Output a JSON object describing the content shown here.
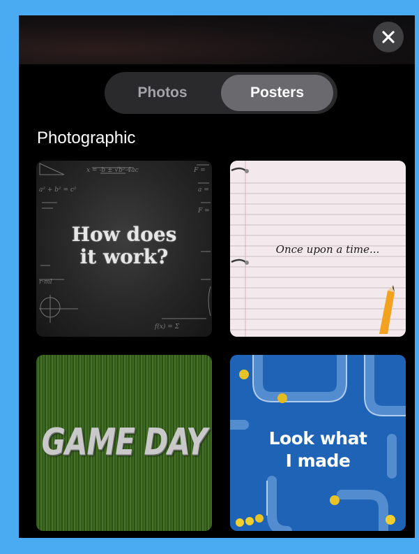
{
  "header": {
    "close_icon": "close-icon"
  },
  "segmented_control": {
    "options": [
      {
        "label": "Photos",
        "selected": false
      },
      {
        "label": "Posters",
        "selected": true
      }
    ]
  },
  "section": {
    "title": "Photographic",
    "tiles": [
      {
        "text": "How does\nit work?",
        "style": "chalkboard"
      },
      {
        "text": "Once upon a time...",
        "style": "notebook"
      },
      {
        "text": "GAME DAY",
        "style": "turf"
      },
      {
        "text": "Look what\nI made",
        "style": "marble-run"
      }
    ]
  },
  "colors": {
    "frame_background": "#000000",
    "page_border": "#4aaaf2",
    "selected_segment": "#6a6a6e",
    "segment_track": "#2a2a2c"
  }
}
